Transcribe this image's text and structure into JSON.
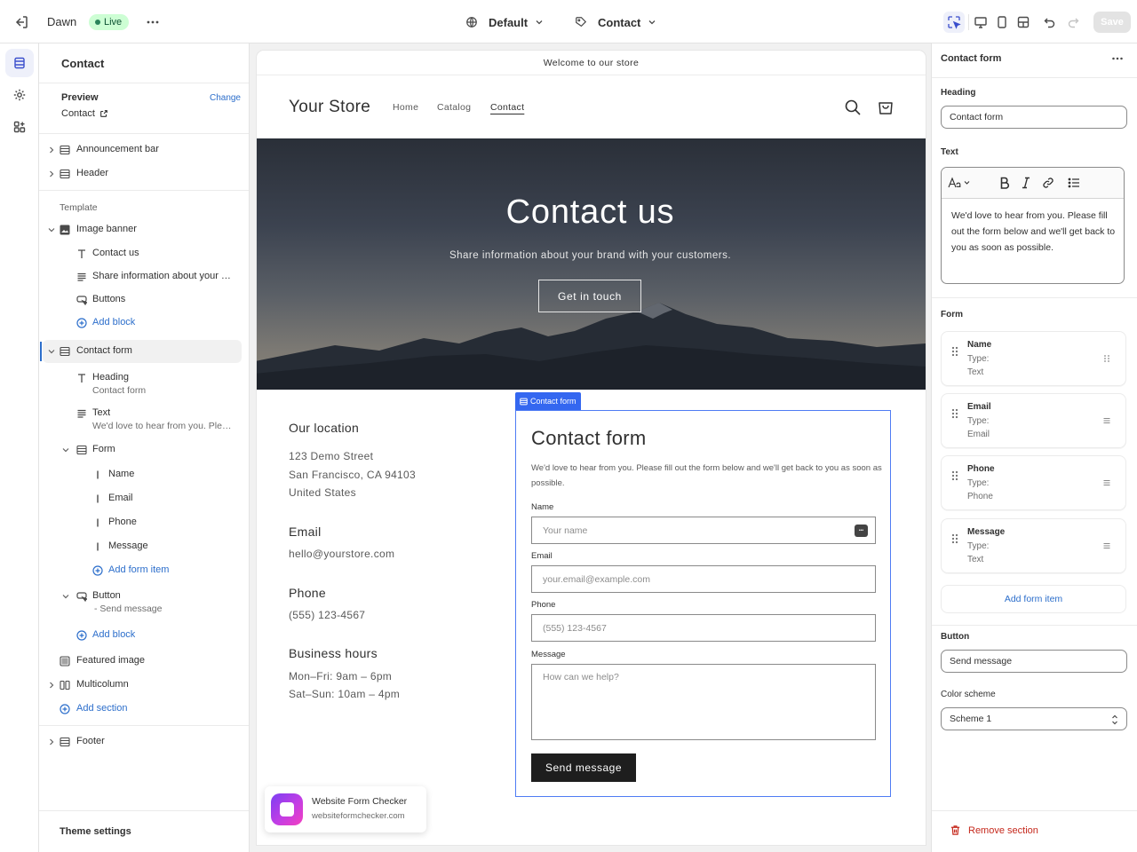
{
  "topbar": {
    "theme_name": "Dawn",
    "status_badge": "Live",
    "template_selector": "Default",
    "page_selector": "Contact",
    "save_label": "Save"
  },
  "sidebar": {
    "title": "Contact",
    "preview_label": "Preview",
    "change_link": "Change",
    "preview_value": "Contact",
    "header_group": [
      {
        "label": "Announcement bar",
        "icon": "section-icon"
      },
      {
        "label": "Header",
        "icon": "section-icon"
      }
    ],
    "template_label": "Template",
    "image_banner": {
      "label": "Image banner",
      "blocks": [
        {
          "label": "Contact us",
          "icon": "text-icon"
        },
        {
          "label": "Share information about your brand with your customers.",
          "icon": "paragraph-icon"
        },
        {
          "label": "Buttons",
          "icon": "button-icon"
        }
      ],
      "add_block": "Add block"
    },
    "contact_form": {
      "label": "Contact form",
      "heading": {
        "label": "Heading",
        "value": "Contact form"
      },
      "text": {
        "label": "Text",
        "value": "We'd love to hear from you. Please fill out the form below and we'll get back to you as soon as possible."
      },
      "form": {
        "label": "Form",
        "items": [
          "Name",
          "Email",
          "Phone",
          "Message"
        ],
        "add_item": "Add form item"
      },
      "button": {
        "label": "Button",
        "value": "- Send message"
      },
      "add_block": "Add block"
    },
    "featured_image": "Featured image",
    "multicolumn": "Multicolumn",
    "add_section": "Add section",
    "footer": "Footer",
    "theme_settings": "Theme settings"
  },
  "preview": {
    "announcement": "Welcome to our store",
    "store_name": "Your Store",
    "nav": [
      "Home",
      "Catalog",
      "Contact"
    ],
    "banner": {
      "title": "Contact us",
      "subtitle": "Share information about your brand with your customers.",
      "button": "Get in touch"
    },
    "location": {
      "heading": "Our location",
      "lines": [
        "123 Demo Street",
        "San Francisco, CA 94103",
        "United States"
      ]
    },
    "email": {
      "heading": "Email",
      "value": "hello@yourstore.com"
    },
    "phone": {
      "heading": "Phone",
      "value": "(555) 123-4567"
    },
    "hours": {
      "heading": "Business hours",
      "lines": [
        "Mon–Fri: 9am – 6pm",
        "Sat–Sun: 10am – 4pm"
      ]
    },
    "form": {
      "tag": "Contact form",
      "title": "Contact form",
      "description": "We'd love to hear from you. Please fill out the form below and we'll get back to you as soon as possible.",
      "fields": [
        {
          "label": "Name",
          "placeholder": "Your name"
        },
        {
          "label": "Email",
          "placeholder": "your.email@example.com"
        },
        {
          "label": "Phone",
          "placeholder": "(555) 123-4567"
        },
        {
          "label": "Message",
          "placeholder": "How can we help?"
        }
      ],
      "password_badge": "•••",
      "submit": "Send message"
    }
  },
  "toast": {
    "title": "Website Form Checker",
    "subtitle": "websiteformchecker.com"
  },
  "settings": {
    "title": "Contact form",
    "heading_label": "Heading",
    "heading_value": "Contact form",
    "text_label": "Text",
    "text_value": "We'd love to hear from you. Please fill out the form below and we'll get back to you as soon as possible.",
    "form_label": "Form",
    "type_label": "Type:",
    "form_items": [
      {
        "name": "Name",
        "type": "Text"
      },
      {
        "name": "Email",
        "type": "Email"
      },
      {
        "name": "Phone",
        "type": "Phone"
      },
      {
        "name": "Message",
        "type": "Text"
      }
    ],
    "add_form_item": "Add form item",
    "button_label": "Button",
    "button_value": "Send message",
    "color_scheme_label": "Color scheme",
    "color_scheme_value": "Scheme 1",
    "remove_section": "Remove section"
  },
  "colors": {
    "accent": "#2c6ecb",
    "live_bg": "#cdfed4",
    "selection_blue": "#3467f0",
    "danger": "#c5281c"
  }
}
